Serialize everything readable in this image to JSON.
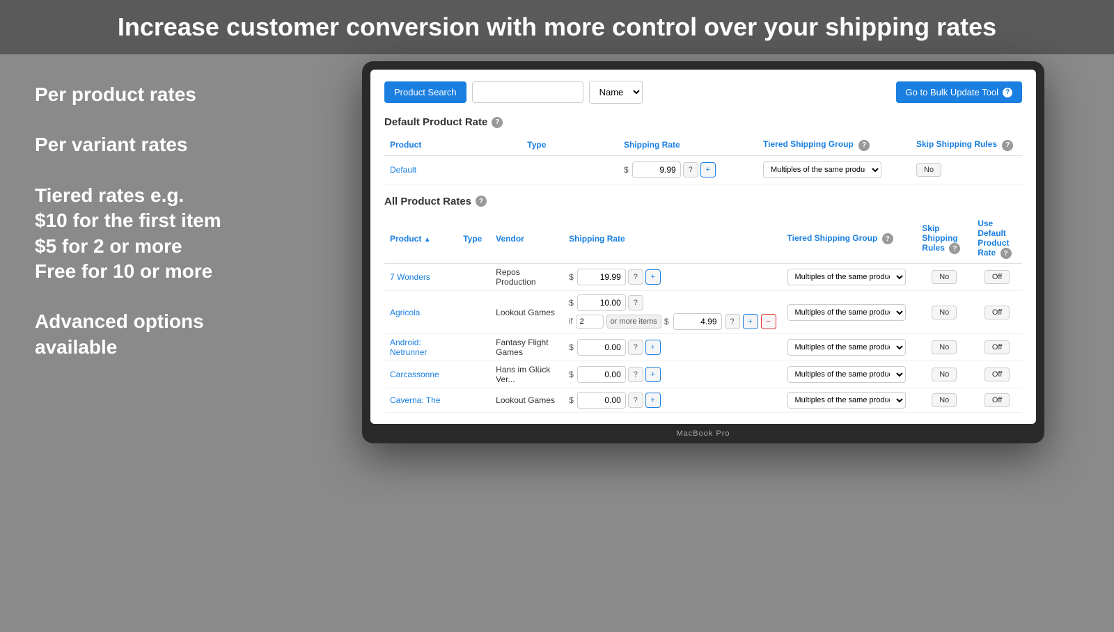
{
  "header": {
    "title": "Increase customer conversion with more control over your shipping rates"
  },
  "sidebar": {
    "features": [
      {
        "id": "per-product",
        "text": "Per product rates"
      },
      {
        "id": "per-variant",
        "text": "Per variant rates"
      },
      {
        "id": "tiered",
        "text": "Tiered rates e.g.\n$10 for the first item\n$5 for 2 or more\nFree for 10 or more"
      },
      {
        "id": "advanced",
        "text": "Advanced options available"
      }
    ]
  },
  "app": {
    "toolbar": {
      "search_button": "Product Search",
      "search_placeholder": "",
      "name_select": "Name",
      "bulk_button": "Go to Bulk Update Tool"
    },
    "default_section": {
      "heading": "Default Product Rate",
      "columns": {
        "product": "Product",
        "type": "Type",
        "shipping_rate": "Shipping Rate",
        "tiered_group": "Tiered Shipping Group",
        "skip_rules": "Skip Shipping Rules"
      },
      "row": {
        "product": "Default",
        "amount": "9.99",
        "tiered_group": "Multiples of the same product",
        "skip_rules": "No"
      }
    },
    "all_section": {
      "heading": "All Product Rates",
      "columns": {
        "product": "Product",
        "type": "Type",
        "vendor": "Vendor",
        "shipping_rate": "Shipping Rate",
        "tiered_group": "Tiered Shipping Group",
        "skip_rules": "Skip Shipping Rules",
        "use_default": "Use Default Product Rate"
      },
      "rows": [
        {
          "id": "7-wonders",
          "product": "7 Wonders",
          "type": "",
          "vendor": "Repos Production",
          "amount": "19.99",
          "tiered_group": "Multiples of the same product",
          "skip_rules": "No",
          "use_default": "Off"
        },
        {
          "id": "agricola",
          "product": "Agricola",
          "type": "",
          "vendor": "Lookout Games",
          "amount": "10.00",
          "amount2": "4.99",
          "tier_qty": "2",
          "tiered_group": "Multiples of the same product",
          "skip_rules": "No",
          "use_default": "Off"
        },
        {
          "id": "android-netrunner",
          "product": "Android: Netrunner",
          "type": "",
          "vendor": "Fantasy Flight Games",
          "amount": "0.00",
          "tiered_group": "Multiples of the same product",
          "skip_rules": "No",
          "use_default": "Off"
        },
        {
          "id": "carcassonne",
          "product": "Carcassonne",
          "type": "",
          "vendor": "Hans im Glück Ver...",
          "amount": "0.00",
          "tiered_group": "Multiples of the same product",
          "skip_rules": "No",
          "use_default": "Off"
        },
        {
          "id": "caverna",
          "product": "Caverna: The",
          "type": "",
          "vendor": "Lookout Games",
          "amount": "0.00",
          "tiered_group": "Multiples of the same product",
          "skip_rules": "No",
          "use_default": "Off"
        }
      ]
    },
    "laptop_brand": "MacBook Pro"
  }
}
